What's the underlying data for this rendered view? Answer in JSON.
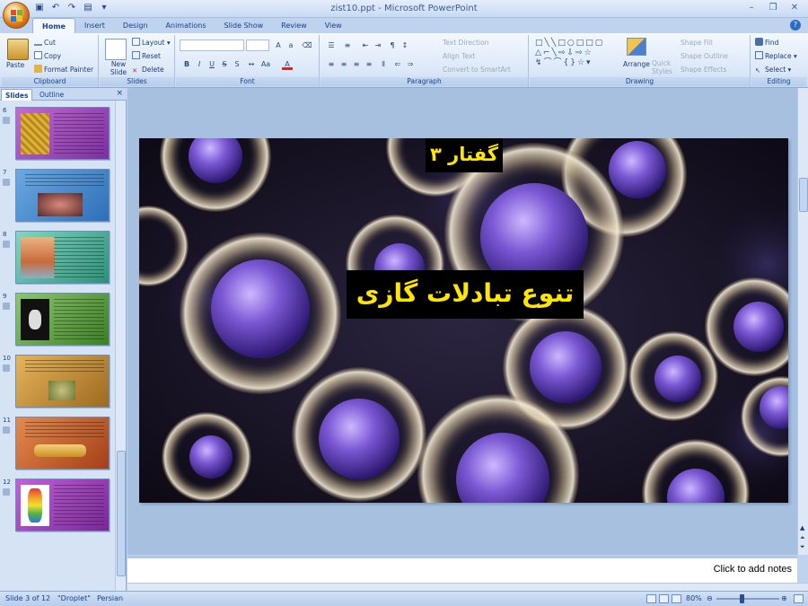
{
  "window": {
    "title": "zist10.ppt - Microsoft PowerPoint"
  },
  "ribbon": {
    "tabs": [
      "Home",
      "Insert",
      "Design",
      "Animations",
      "Slide Show",
      "Review",
      "View"
    ],
    "clipboard": {
      "label": "Clipboard",
      "paste": "Paste",
      "cut": "Cut",
      "copy": "Copy",
      "format_painter": "Format Painter"
    },
    "slides": {
      "label": "Slides",
      "new_slide": "New Slide",
      "layout": "Layout",
      "reset": "Reset",
      "delete": "Delete"
    },
    "font": {
      "label": "Font"
    },
    "paragraph": {
      "label": "Paragraph",
      "text_direction": "Text Direction",
      "align_text": "Align Text",
      "convert_smartart": "Convert to SmartArt"
    },
    "drawing": {
      "label": "Drawing",
      "arrange": "Arrange",
      "quick_styles": "Quick Styles",
      "shape_fill": "Shape Fill",
      "shape_outline": "Shape Outline",
      "shape_effects": "Shape Effects"
    },
    "editing": {
      "label": "Editing",
      "find": "Find",
      "replace": "Replace",
      "select": "Select"
    }
  },
  "pane": {
    "tab_slides": "Slides",
    "tab_outline": "Outline",
    "close": "×",
    "thumbnails": [
      {
        "num": "6",
        "bg": "#a53fb9"
      },
      {
        "num": "7",
        "bg": "#3b82c9"
      },
      {
        "num": "8",
        "bg": "#3aa78f"
      },
      {
        "num": "9",
        "bg": "#5e9b3b"
      },
      {
        "num": "10",
        "bg": "#c48a2f"
      },
      {
        "num": "11",
        "bg": "#c15a2a"
      },
      {
        "num": "12",
        "bg": "#9c3fb7"
      }
    ]
  },
  "slide": {
    "subtitle": "گفتار ۳",
    "title": "تنوع تبادلات گازی",
    "title_color": "#ffe600"
  },
  "notes": {
    "placeholder": "Click to add notes"
  },
  "status": {
    "slide_info": "Slide 3 of 12",
    "theme": "\"Droplet\"",
    "language": "Persian",
    "zoom": "80%"
  }
}
